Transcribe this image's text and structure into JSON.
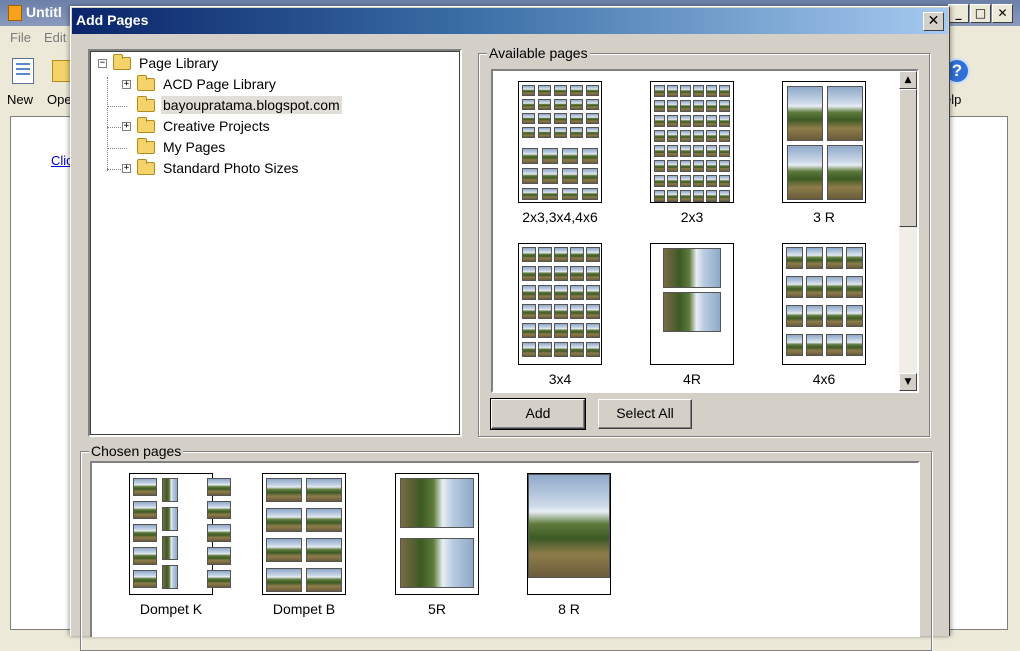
{
  "app": {
    "title": "Untitl",
    "menu": {
      "file": "File",
      "edit": "Edit"
    },
    "toolbar": {
      "new_label": "New",
      "open_label": "Ope",
      "help_label": "elp",
      "help_glyph": "?"
    },
    "window_buttons": {
      "minimize": "_",
      "maximize": "□",
      "close": "✕"
    },
    "link_text": "Clic"
  },
  "dialog": {
    "title": "Add Pages",
    "close_glyph": "✕",
    "tree": {
      "root": {
        "label": "Page Library",
        "expander": "−"
      },
      "items": [
        {
          "label": "ACD Page Library",
          "expander": "+"
        },
        {
          "label": "bayoupratama.blogspot.com",
          "expander": "",
          "selected": true
        },
        {
          "label": "Creative Projects",
          "expander": "+"
        },
        {
          "label": "My Pages",
          "expander": ""
        },
        {
          "label": "Standard Photo Sizes",
          "expander": "+"
        }
      ]
    },
    "available": {
      "title": "Available pages",
      "items": [
        {
          "caption": "2x3,3x4,4x6",
          "layout": "mixed-grid"
        },
        {
          "caption": "2x3",
          "layout": "grid-2x3"
        },
        {
          "caption": "3 R",
          "layout": "grid-3r"
        },
        {
          "caption": "3x4",
          "layout": "grid-3x4"
        },
        {
          "caption": "4R",
          "layout": "grid-4r"
        },
        {
          "caption": "4x6",
          "layout": "grid-4x6"
        }
      ],
      "scroll_up": "▲",
      "scroll_down": "▼"
    },
    "buttons": {
      "add": "Add",
      "select_all": "Select All"
    },
    "chosen": {
      "title": "Chosen pages",
      "items": [
        {
          "caption": "Dompet K",
          "layout": "dompet-k"
        },
        {
          "caption": "Dompet B",
          "layout": "dompet-b"
        },
        {
          "caption": "5R",
          "layout": "grid-5r"
        },
        {
          "caption": "8 R",
          "layout": "full-8r"
        }
      ]
    }
  }
}
